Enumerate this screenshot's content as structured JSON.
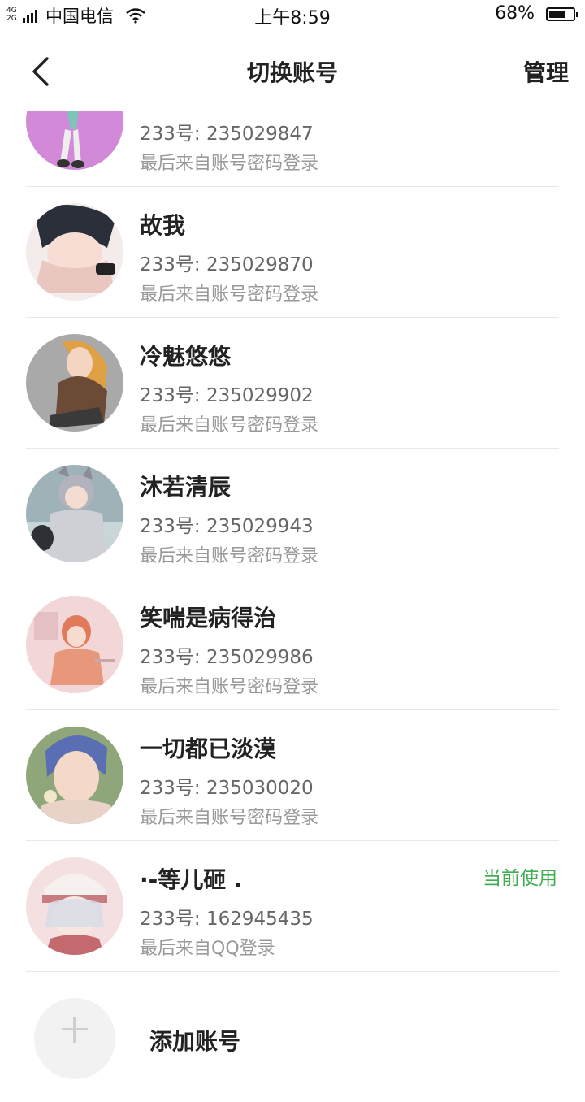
{
  "status_bar": {
    "network": "4G\n2G",
    "carrier": "中国电信",
    "time": "上午8:59",
    "battery_pct": "68%",
    "battery_level": 0.68
  },
  "nav": {
    "title": "切换账号",
    "manage_label": "管理",
    "back_icon": "back-arrow-icon"
  },
  "accounts": [
    {
      "name": "",
      "id": "233号: 235029847",
      "login": "最后来自账号密码登录",
      "current": ""
    },
    {
      "name": "故我",
      "id": "233号: 235029870",
      "login": "最后来自账号密码登录",
      "current": ""
    },
    {
      "name": "冷魅悠悠",
      "id": "233号: 235029902",
      "login": "最后来自账号密码登录",
      "current": ""
    },
    {
      "name": "沐若清辰",
      "id": "233号: 235029943",
      "login": "最后来自账号密码登录",
      "current": ""
    },
    {
      "name": "笑喘是病得治",
      "id": "233号: 235029986",
      "login": "最后来自账号密码登录",
      "current": ""
    },
    {
      "name": "一切都已淡漠",
      "id": "233号: 235030020",
      "login": "最后来自账号密码登录",
      "current": ""
    },
    {
      "name": "·-等儿砸 .",
      "id": "233号: 162945435",
      "login": "最后来自QQ登录",
      "current": "当前使用"
    }
  ],
  "add_account": {
    "label": "添加账号",
    "icon": "plus-icon"
  },
  "colors": {
    "accent_green": "#3fae51",
    "divider": "#e8e8e8"
  }
}
